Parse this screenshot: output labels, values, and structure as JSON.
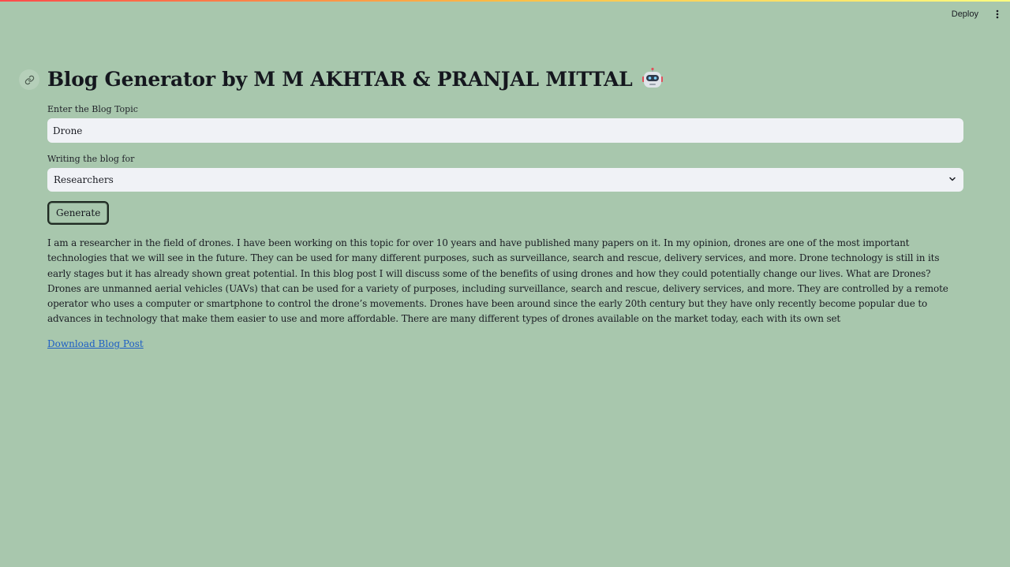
{
  "header": {
    "deploy_label": "Deploy",
    "menu_icon": "vertical-dots-icon"
  },
  "main": {
    "title": "Blog Generator by M M AKHTAR & PRANJAL MITTAL",
    "title_icon": "robot-icon",
    "topic_field": {
      "label": "Enter the Blog Topic",
      "value": "Drone"
    },
    "audience_field": {
      "label": "Writing the blog for",
      "selected": "Researchers"
    },
    "generate_label": "Generate",
    "blog_text": "I am a researcher in the field of drones. I have been working on this topic for over 10 years and have published many papers on it. In my opinion, drones are one of the most important technologies that we will see in the future. They can be used for many different purposes, such as surveillance, search and rescue, delivery services, and more. Drone technology is still in its early stages but it has already shown great potential. In this blog post I will discuss some of the benefits of using drones and how they could potentially change our lives. What are Drones? Drones are unmanned aerial vehicles (UAVs) that can be used for a variety of purposes, including surveillance, search and rescue, delivery services, and more. They are controlled by a remote operator who uses a computer or smartphone to control the drone’s movements. Drones have been around since the early 20th century but they have only recently become popular due to advances in technology that make them easier to use and more affordable. There are many different types of drones available on the market today, each with its own set",
    "download_label": "Download Blog Post"
  },
  "colors": {
    "background": "#a8c7ad",
    "input_background": "#f0f2f6",
    "link": "#1e5fc5"
  }
}
